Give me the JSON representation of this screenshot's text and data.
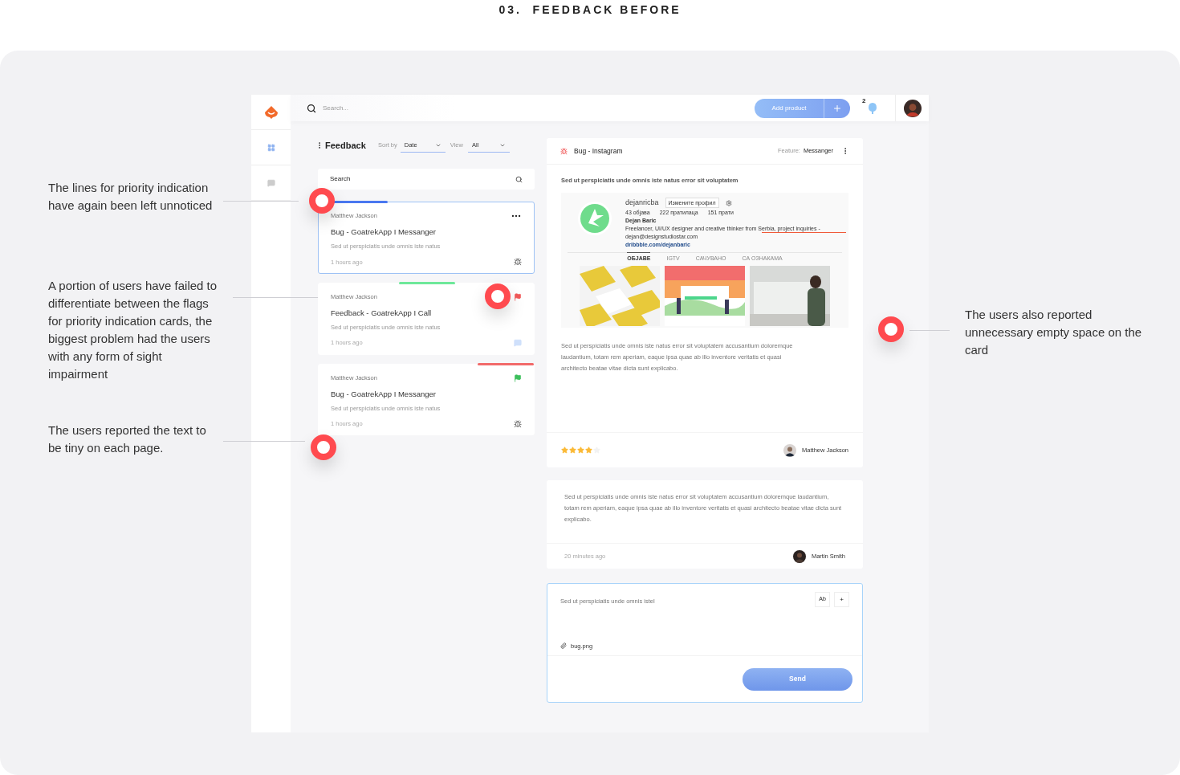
{
  "page_title": "03.  FEEDBACK BEFORE",
  "annotations": [
    {
      "text": "The lines for priority indication have again been left unnoticed"
    },
    {
      "text": "A portion of users have failed to differentiate between the flags for priority indication cards, the biggest problem had the users with any form of sight impairment"
    },
    {
      "text": "The users reported the text to be tiny on each page."
    },
    {
      "text": "The users also reported unnecessary empty space on the card"
    }
  ],
  "topbar": {
    "search_placeholder": "Search...",
    "add_button": "Add product",
    "notification_count": "2"
  },
  "sidebar": [
    {
      "kind": "grid",
      "selected": true
    },
    {
      "kind": "chat",
      "selected": false
    }
  ],
  "list": {
    "title": "Feedback",
    "sort_label": "Sort by",
    "sort_value": "Date",
    "view_label": "View",
    "view_value": "All",
    "search_placeholder": "Search",
    "cards": [
      {
        "author": "Matthew Jackson",
        "title": "Bug - GoatrekApp I Messanger",
        "text": "Sed ut perspiciatis unde omnis iste natus",
        "time": "1 hours ago",
        "selected": true,
        "color": "#4a78f0",
        "menu": true,
        "kind": "bug"
      },
      {
        "author": "Matthew Jackson",
        "title": "Feedback - GoatrekApp I Call",
        "text": "Sed ut perspiciatis unde omnis iste natus",
        "time": "1 hours ago",
        "selected": false,
        "color": "#6ee89a",
        "menu": false,
        "flag": {
          "color": "#f25a5a"
        },
        "kind": "comment"
      },
      {
        "author": "Matthew Jackson",
        "title": "Bug - GoatrekApp I Messanger",
        "text": "Sed ut perspiciatis unde omnis iste natus",
        "time": "1 hours ago",
        "selected": false,
        "color": "#f26a6a",
        "menu": false,
        "flag": {
          "color": "#3cbf5c"
        },
        "kind": "bug"
      }
    ]
  },
  "detail": {
    "title": "Bug - Instagram",
    "feature_label": "Feature:",
    "feature_value": "Messanger",
    "subject": "Sed ut perspiciatis unde omnis iste natus error sit voluptatem",
    "screenshot": {
      "username": "dejanricba",
      "edit_button": "Измените профил",
      "stats": [
        "43 објава",
        "222 пратилаца",
        "151 прати"
      ],
      "name": "Dejan Baric",
      "bio": "Freelancer, UI/UX designer and creative thinker from Serbia, project inquiries -",
      "email": "dejan@designstudiostar.com",
      "link": "dribbble.com/dejanbaric",
      "tabs": [
        {
          "label": "ОБЈАВЕ",
          "selected": true
        },
        {
          "label": "IGTV",
          "selected": false
        },
        {
          "label": "САЧУВАНО",
          "selected": false
        },
        {
          "label": "СА ОЗНАКАМА",
          "selected": false
        }
      ],
      "posts": [
        {
          "kind": "picture"
        },
        {
          "kind": "picture"
        },
        {
          "kind": "picture"
        }
      ]
    },
    "body": "Sed ut perspiciatis unde omnis iste natus error sit voluptatem accusantium doloremque laudantium, totam rem aperiam, eaque ipsa quae ab illo inventore veritatis et quasi architecto beatae vitae dicta sunt explicabo.",
    "stars": 4,
    "author": "Matthew Jackson"
  },
  "comment": {
    "text": "Sed ut perspiciatis unde omnis iste natus error sit voluptatem accusantium doloremque laudantium, totam rem aperiam, eaque ipsa quae ab illo inventore veritatis et quasi architecto beatae vitae dicta sunt explicabo.",
    "time": "20 minutes ago",
    "author": "Martin Smith"
  },
  "reply": {
    "value": "Sed ut perspiciatis unde omnis istel",
    "format_button": "Ab",
    "add_button": "+",
    "attachment": "bug.png",
    "send": "Send"
  }
}
